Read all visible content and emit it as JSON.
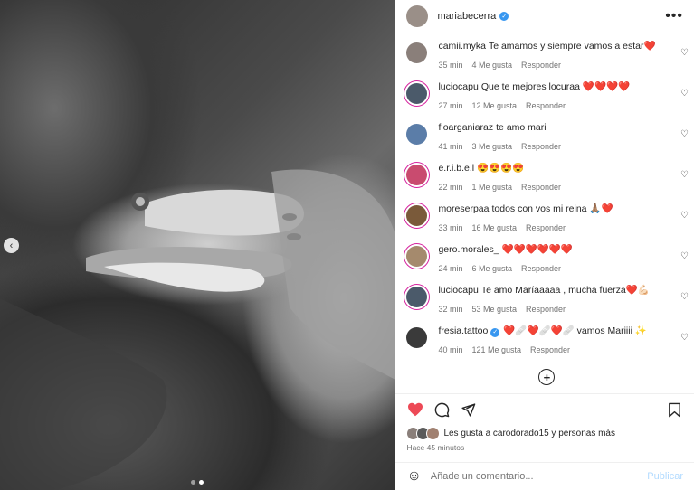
{
  "post": {
    "username": "mariabecerra",
    "more_label": "•••"
  },
  "comments": [
    {
      "user": "camii.myka",
      "text": "Te amamos y siempre vamos a estar❤️",
      "time": "35 min",
      "likes": "4 Me gusta",
      "reply": "Responder",
      "avatar_color": "#8a7f7a"
    },
    {
      "user": "luciocapu",
      "text": "Que te mejores locuraa ❤️❤️❤️❤️",
      "time": "27 min",
      "likes": "12 Me gusta",
      "reply": "Responder",
      "avatar_color": "#4b5a6a"
    },
    {
      "user": "fioarganiaraz",
      "text": "te amo mari",
      "time": "41 min",
      "likes": "3 Me gusta",
      "reply": "Responder",
      "avatar_color": "#5b7da8"
    },
    {
      "user": "e.r.i.b.e.l",
      "text": "😍😍😍😍",
      "time": "22 min",
      "likes": "1 Me gusta",
      "reply": "Responder",
      "avatar_color": "#c94b6f"
    },
    {
      "user": "moreserpaa",
      "text": "todos con vos mi reina 🙏🏽❤️",
      "time": "33 min",
      "likes": "16 Me gusta",
      "reply": "Responder",
      "avatar_color": "#7a5a3a"
    },
    {
      "user": "gero.morales_",
      "text": "❤️❤️❤️❤️❤️❤️",
      "time": "24 min",
      "likes": "6 Me gusta",
      "reply": "Responder",
      "avatar_color": "#a58a6d"
    },
    {
      "user": "luciocapu",
      "text": "Te amo Maríaaaaa , mucha fuerza❤️💪🏻",
      "time": "32 min",
      "likes": "53 Me gusta",
      "reply": "Responder",
      "avatar_color": "#4b5a6a"
    },
    {
      "user": "fresia.tattoo",
      "text": "❤️🩹❤️🩹❤️🩹 vamos Mariiii ✨",
      "time": "40 min",
      "likes": "121 Me gusta",
      "reply": "Responder",
      "avatar_color": "#3a3a3a"
    }
  ],
  "likes": {
    "text": "Les gusta a carodorado15 y personas más"
  },
  "timestamp": "Hace 45 minutos",
  "add_comment": {
    "placeholder": "Añade un comentario...",
    "post_label": "Publicar"
  },
  "icons": {
    "heart": "heart-icon",
    "comment": "comment-icon",
    "share": "share-icon",
    "bookmark": "bookmark-icon",
    "emoji": "emoji-icon",
    "add": "plus-circle-icon",
    "carousel_prev": "chevron-left-icon"
  },
  "colors": {
    "like_red": "#ed4956",
    "verified_blue": "#3897f0",
    "publish_disabled": "#b3dbff"
  }
}
